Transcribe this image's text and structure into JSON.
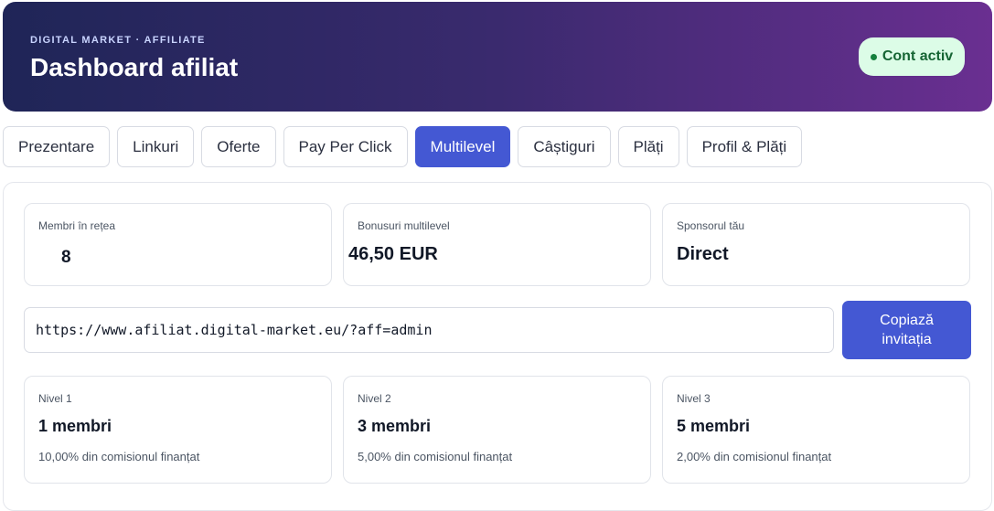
{
  "header": {
    "kicker": "DIGITAL MARKET · AFFILIATE",
    "title": "Dashboard afiliat",
    "status_label": "Cont activ",
    "status_color": "#15803d"
  },
  "tabs": [
    {
      "label": "Prezentare",
      "active": false
    },
    {
      "label": "Linkuri",
      "active": false
    },
    {
      "label": "Oferte",
      "active": false
    },
    {
      "label": "Pay Per Click",
      "active": false
    },
    {
      "label": "Multilevel",
      "active": true
    },
    {
      "label": "Câștiguri",
      "active": false
    },
    {
      "label": "Plăți",
      "active": false
    },
    {
      "label": "Profil & Plăți",
      "active": false
    }
  ],
  "stats": {
    "members": {
      "label": "Membri în rețea",
      "value": "8"
    },
    "bonuses": {
      "label": "Bonusuri multilevel",
      "value": "46,50 EUR"
    },
    "sponsor": {
      "label": "Sponsorul tău",
      "value": "Direct"
    }
  },
  "invite": {
    "url": "https://www.afiliat.digital-market.eu/?aff=admin",
    "copy_label": "Copiază invitația"
  },
  "levels": [
    {
      "label": "Nivel 1",
      "members": "1 membri",
      "commission": "10,00% din comisionul finanțat"
    },
    {
      "label": "Nivel 2",
      "members": "3 membri",
      "commission": "5,00% din comisionul finanțat"
    },
    {
      "label": "Nivel 3",
      "members": "5 membri",
      "commission": "2,00% din comisionul finanțat"
    }
  ],
  "colors": {
    "accent": "#4458d3",
    "header_gradient_start": "#1f2557",
    "header_gradient_end": "#6a2f91",
    "status_bg": "#dcfce7"
  }
}
